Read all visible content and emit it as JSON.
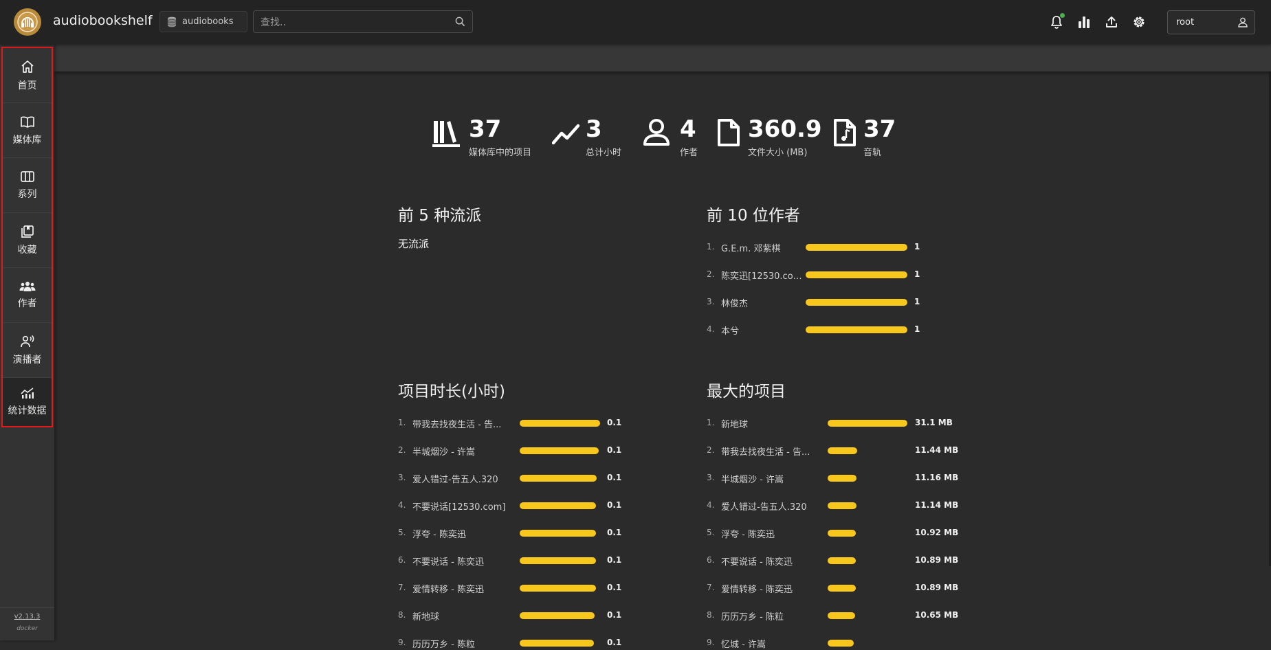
{
  "topbar": {
    "app_title": "audiobookshelf",
    "library_name": "audiobooks",
    "search_placeholder": "查找..",
    "username": "root"
  },
  "sidebar": {
    "items": [
      {
        "label": "首页",
        "icon": "home-icon"
      },
      {
        "label": "媒体库",
        "icon": "book-open-icon"
      },
      {
        "label": "系列",
        "icon": "columns-icon"
      },
      {
        "label": "收藏",
        "icon": "collection-icon"
      },
      {
        "label": "作者",
        "icon": "people-icon"
      },
      {
        "label": "演播者",
        "icon": "narrator-icon"
      },
      {
        "label": "统计数据",
        "icon": "stats-icon"
      }
    ],
    "version": "v2.13.3",
    "build": "docker"
  },
  "stats": [
    {
      "value": "37",
      "caption": "媒体库中的项目",
      "icon": "library-icon"
    },
    {
      "value": "3",
      "caption": "总计小时",
      "icon": "trend-icon"
    },
    {
      "value": "4",
      "caption": "作者",
      "icon": "person-icon"
    },
    {
      "value": "360.9",
      "caption": "文件大小 (MB)",
      "icon": "file-icon"
    },
    {
      "value": "37",
      "caption": "音轨",
      "icon": "music-file-icon"
    }
  ],
  "genres": {
    "title": "前 5 种流派",
    "empty": "无流派"
  },
  "authors": {
    "title": "前 10 位作者",
    "rows": [
      {
        "idx": "1.",
        "name": "G.E.m. 邓紫棋",
        "value": "1",
        "fraction": 1.0
      },
      {
        "idx": "2.",
        "name": "陈奕迅[12530.com]",
        "value": "1",
        "fraction": 1.0
      },
      {
        "idx": "3.",
        "name": "林俊杰",
        "value": "1",
        "fraction": 1.0
      },
      {
        "idx": "4.",
        "name": "本兮",
        "value": "1",
        "fraction": 1.0
      }
    ]
  },
  "durations": {
    "title": "项目时长(小时)",
    "rows": [
      {
        "idx": "1.",
        "name": "带我去找夜生活 - 告...",
        "value": "0.1",
        "fraction": 1.0
      },
      {
        "idx": "2.",
        "name": "半城烟沙 - 许嵩",
        "value": "0.1",
        "fraction": 0.98
      },
      {
        "idx": "3.",
        "name": "爱人错过-告五人.320",
        "value": "0.1",
        "fraction": 0.96
      },
      {
        "idx": "4.",
        "name": "不要说话[12530.com]",
        "value": "0.1",
        "fraction": 0.95
      },
      {
        "idx": "5.",
        "name": "浮夸 - 陈奕迅",
        "value": "0.1",
        "fraction": 0.95
      },
      {
        "idx": "6.",
        "name": "不要说话 - 陈奕迅",
        "value": "0.1",
        "fraction": 0.95
      },
      {
        "idx": "7.",
        "name": "爱情转移 - 陈奕迅",
        "value": "0.1",
        "fraction": 0.95
      },
      {
        "idx": "8.",
        "name": "新地球",
        "value": "0.1",
        "fraction": 0.93
      },
      {
        "idx": "9.",
        "name": "历历万乡 - 陈粒",
        "value": "0.1",
        "fraction": 0.92
      }
    ]
  },
  "largest": {
    "title": "最大的项目",
    "rows": [
      {
        "idx": "1.",
        "name": "新地球",
        "value": "31.1 MB",
        "fraction": 1.0
      },
      {
        "idx": "2.",
        "name": "带我去找夜生活 - 告...",
        "value": "11.44 MB",
        "fraction": 0.368
      },
      {
        "idx": "3.",
        "name": "半城烟沙 - 许嵩",
        "value": "11.16 MB",
        "fraction": 0.359
      },
      {
        "idx": "4.",
        "name": "爱人错过-告五人.320",
        "value": "11.14 MB",
        "fraction": 0.358
      },
      {
        "idx": "5.",
        "name": "浮夸 - 陈奕迅",
        "value": "10.92 MB",
        "fraction": 0.351
      },
      {
        "idx": "6.",
        "name": "不要说话 - 陈奕迅",
        "value": "10.89 MB",
        "fraction": 0.35
      },
      {
        "idx": "7.",
        "name": "爱情转移 - 陈奕迅",
        "value": "10.89 MB",
        "fraction": 0.35
      },
      {
        "idx": "8.",
        "name": "历历万乡 - 陈粒",
        "value": "10.65 MB",
        "fraction": 0.342
      },
      {
        "idx": "9.",
        "name": "忆城 - 许嵩",
        "value": "",
        "fraction": 0.33
      }
    ]
  },
  "colors": {
    "accent_bar": "#f7c71c",
    "highlight_border": "#e11b1b",
    "notification_dot": "#4caf50"
  }
}
